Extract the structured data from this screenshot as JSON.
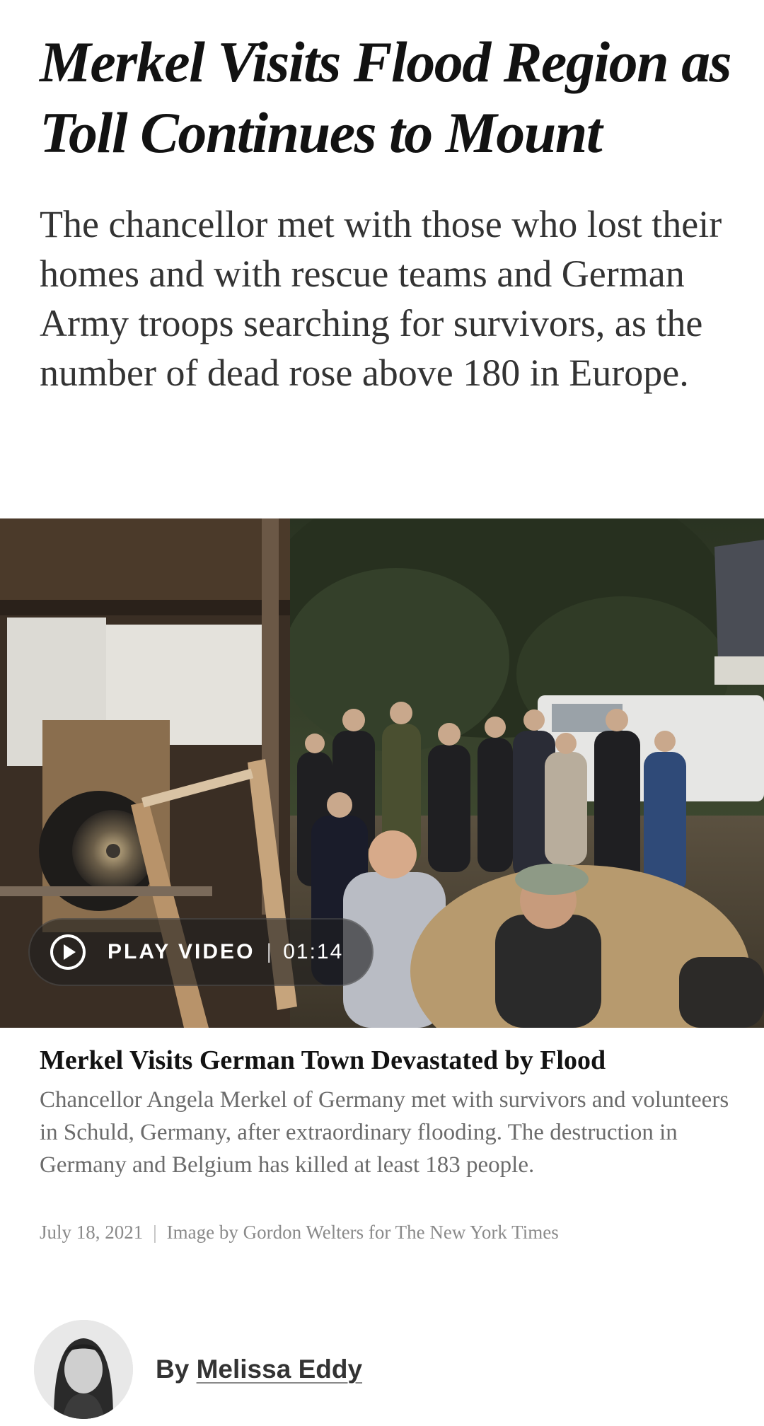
{
  "article": {
    "headline": "Merkel Visits Flood Region as Toll Continues to Mount",
    "summary": "The chancellor met with those who lost their homes and with rescue teams and German Army troops searching for survivors, as the number of dead rose above 180 in Europe."
  },
  "video": {
    "play_label": "PLAY VIDEO",
    "separator": "|",
    "duration": "01:14",
    "icon": "play-circle-icon",
    "title": "Merkel Visits German Town Devastated by Flood",
    "description": "Chancellor Angela Merkel of Germany met with survivors and volunteers in Schuld, Germany, after extraordinary flooding. The destruction in Germany and Belgium has killed at least 183 people.",
    "date": "July 18, 2021",
    "meta_separator": "|",
    "credit": "Image by Gordon Welters for The New York Times"
  },
  "byline": {
    "prefix": "By",
    "author": "Melissa Eddy"
  },
  "colors": {
    "headline": "#121212",
    "summary": "#333333",
    "caption": "#6b6b6b",
    "meta": "#8a8a8a"
  }
}
